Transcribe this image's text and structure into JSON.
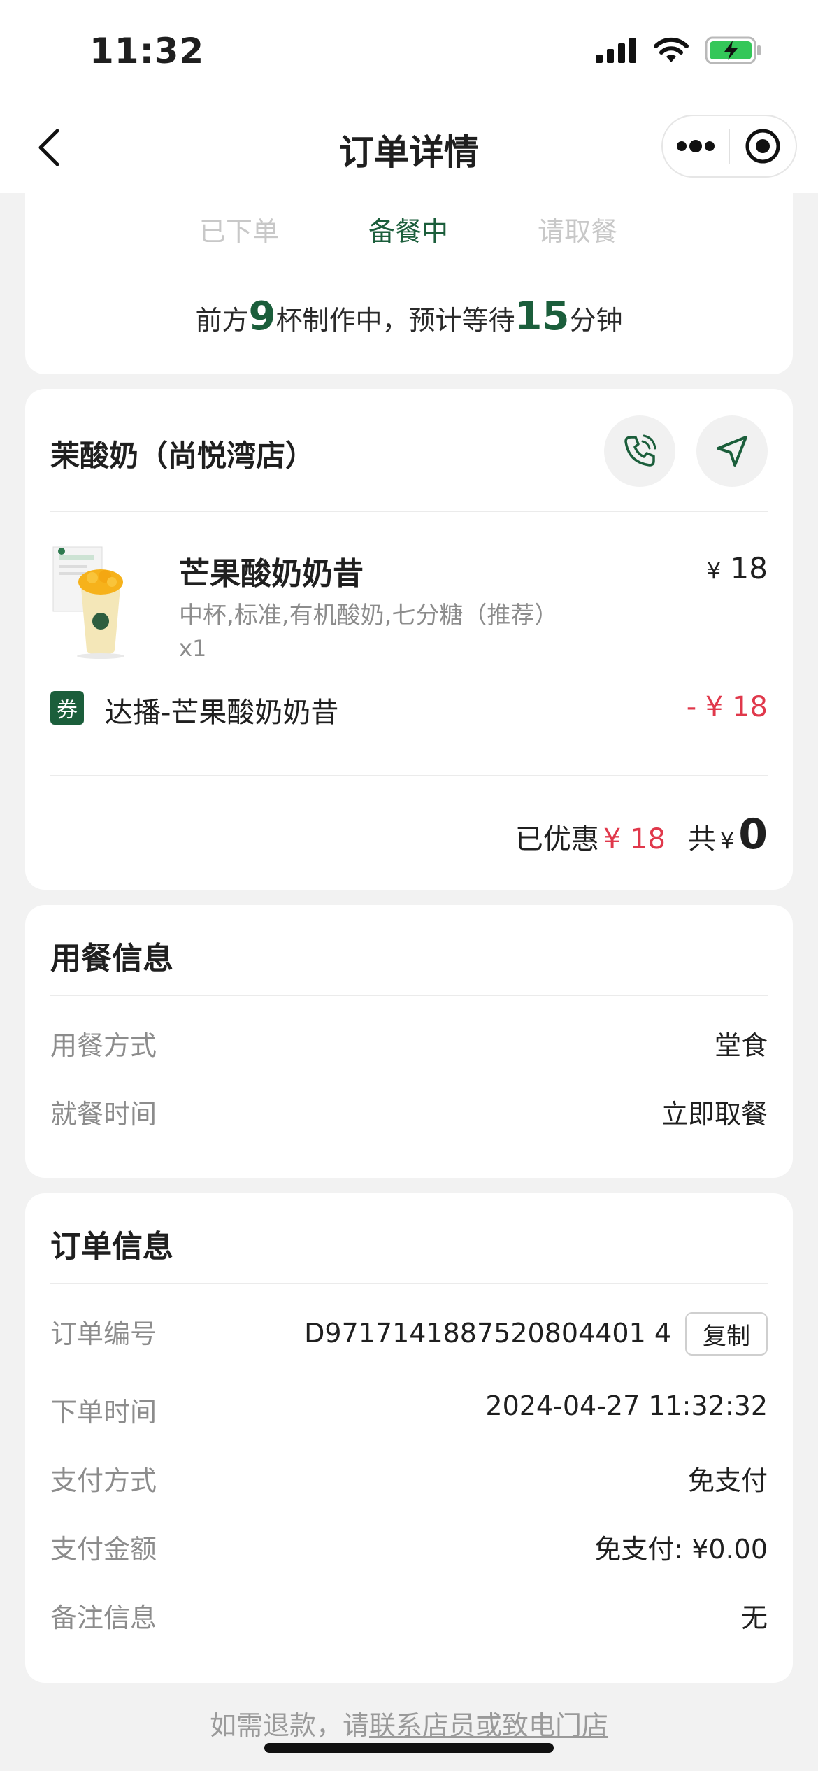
{
  "status_bar": {
    "time": "11:32"
  },
  "nav": {
    "title": "订单详情",
    "more_icon": "more-dots-icon",
    "close_icon": "target-circle-icon"
  },
  "progress": {
    "steps": [
      {
        "label": "已下单",
        "state": "done"
      },
      {
        "label": "备餐中",
        "state": "active"
      },
      {
        "label": "请取餐",
        "state": "pending"
      }
    ],
    "wait_prefix": "前方",
    "cups_ahead": "9",
    "wait_middle": "杯制作中，预计等待",
    "wait_minutes": "15",
    "wait_suffix": "分钟"
  },
  "store": {
    "name": "茉酸奶（尚悦湾店）",
    "item": {
      "name": "芒果酸奶奶昔",
      "currency": "¥",
      "price": "18",
      "spec": "中杯,标准,有机酸奶,七分糖（推荐）",
      "qty": "x1"
    },
    "coupon": {
      "badge": "券",
      "name": "达播-芒果酸奶奶昔",
      "amount": "- ¥ 18"
    },
    "summary": {
      "discount_label": "已优惠",
      "discount_amount": "¥ 18",
      "total_label": "共",
      "currency": "¥",
      "total": "0"
    }
  },
  "dining": {
    "title": "用餐信息",
    "rows": [
      {
        "label": "用餐方式",
        "value": "堂食"
      },
      {
        "label": "就餐时间",
        "value": "立即取餐"
      }
    ]
  },
  "order": {
    "title": "订单信息",
    "number_label": "订单编号",
    "number": "D9717141887520804401 4",
    "copy_label": "复制",
    "rows": [
      {
        "label": "下单时间",
        "value": "2024-04-27 11:32:32"
      },
      {
        "label": "支付方式",
        "value": "免支付"
      },
      {
        "label": "支付金额",
        "value": "免支付: ¥0.00"
      },
      {
        "label": "备注信息",
        "value": "无"
      }
    ]
  },
  "footer": {
    "refund_prefix": "如需退款，请",
    "refund_link": "联系店员或致电门店"
  },
  "colors": {
    "brand_green": "#1b5e3b",
    "discount_red": "#e0384b"
  }
}
